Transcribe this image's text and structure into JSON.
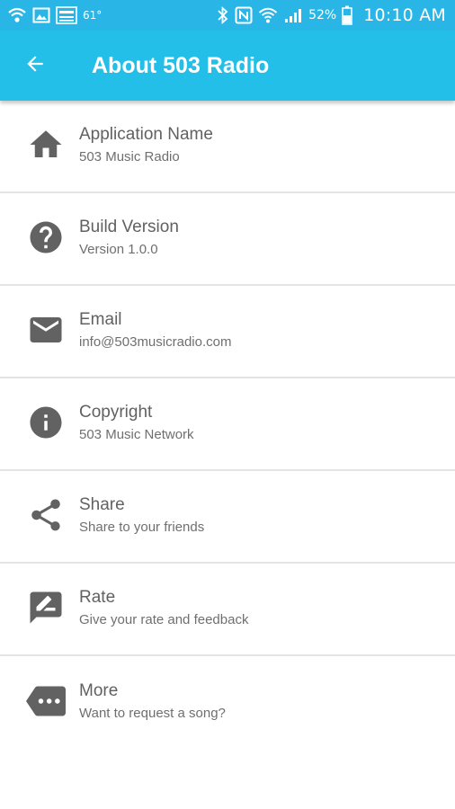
{
  "statusbar": {
    "temperature": "61°",
    "battery_percent": "52%",
    "time": "10:10 AM",
    "bg_color": "#29b6e6"
  },
  "appbar": {
    "title": "About 503 Radio",
    "bg_color": "#23bfe9",
    "back_icon": "arrow-left-icon"
  },
  "items": [
    {
      "icon": "home-icon",
      "title": "Application Name",
      "subtitle": "503 Music Radio"
    },
    {
      "icon": "help-circle-icon",
      "title": "Build Version",
      "subtitle": "Version 1.0.0"
    },
    {
      "icon": "email-icon",
      "title": "Email",
      "subtitle": "info@503musicradio.com"
    },
    {
      "icon": "info-icon",
      "title": "Copyright",
      "subtitle": "503 Music Network"
    },
    {
      "icon": "share-icon",
      "title": "Share",
      "subtitle": "Share to your friends"
    },
    {
      "icon": "rate-review-icon",
      "title": "Rate",
      "subtitle": "Give your rate and feedback"
    },
    {
      "icon": "more-tag-icon",
      "title": "More",
      "subtitle": "Want to request a song?"
    }
  ]
}
